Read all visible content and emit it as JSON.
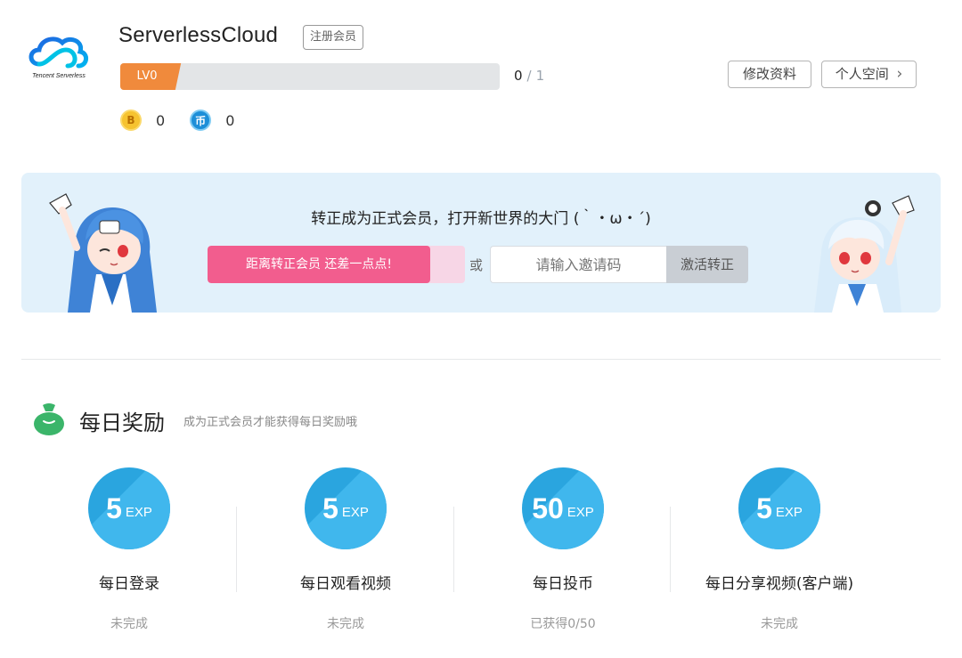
{
  "header": {
    "logo_text": "Tencent Serverless",
    "username": "ServerlessCloud",
    "register_badge": "注册会员",
    "level_label": "LV0",
    "level_current": "0",
    "level_separator": "/",
    "level_max": "1",
    "level_progress": 0,
    "coins": [
      {
        "icon": "b-coin-icon",
        "glyph": "B",
        "value": "0"
      },
      {
        "icon": "yuan-coin-icon",
        "glyph": "币",
        "value": "0"
      }
    ],
    "edit_profile_label": "修改资料",
    "personal_space_label": "个人空间",
    "personal_space_chevron": "›"
  },
  "banner": {
    "title": "转正成为正式会员，打开新世界的大门 (｀・ω・´)",
    "progress_text": "距离转正会员 还差一点点!",
    "or_text": "或",
    "invite_placeholder": "请输入邀请码",
    "activate_label": "激活转正"
  },
  "rewards": {
    "title": "每日奖励",
    "subtitle": "成为正式会员才能获得每日奖励哦",
    "tasks": [
      {
        "value": "5",
        "unit": "EXP",
        "label": "每日登录",
        "status": "未完成"
      },
      {
        "value": "5",
        "unit": "EXP",
        "label": "每日观看视频",
        "status": "未完成"
      },
      {
        "value": "50",
        "unit": "EXP",
        "label": "每日投币",
        "status": "已获得0/50"
      },
      {
        "value": "5",
        "unit": "EXP",
        "label": "每日分享视频(客户端)",
        "status": "未完成"
      }
    ]
  },
  "colors": {
    "level_orange": "#f08a3c",
    "accent_pink": "#f25d8e",
    "banner_bg": "#e2f1fb",
    "badge_blue": "#2aa5df",
    "reward_green": "#3bb56a"
  }
}
